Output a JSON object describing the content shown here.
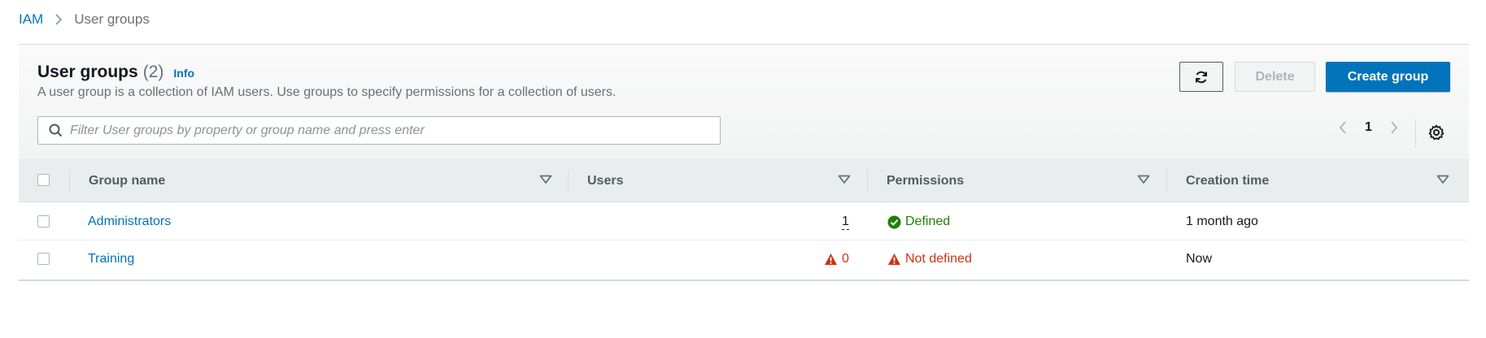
{
  "breadcrumb": {
    "root": "IAM",
    "current": "User groups"
  },
  "header": {
    "title": "User groups",
    "count": "(2)",
    "info": "Info",
    "description": "A user group is a collection of IAM users. Use groups to specify permissions for a collection of users."
  },
  "actions": {
    "refresh_icon": "refresh-icon",
    "delete_label": "Delete",
    "create_label": "Create group"
  },
  "search": {
    "placeholder": "Filter User groups by property or group name and press enter",
    "value": ""
  },
  "pagination": {
    "current_page": "1"
  },
  "table": {
    "columns": [
      "Group name",
      "Users",
      "Permissions",
      "Creation time"
    ],
    "rows": [
      {
        "name": "Administrators",
        "users": "1",
        "users_warning": false,
        "permissions": "Defined",
        "permissions_status": "ok",
        "created": "1 month ago"
      },
      {
        "name": "Training",
        "users": "0",
        "users_warning": true,
        "permissions": "Not defined",
        "permissions_status": "error",
        "created": "Now"
      }
    ]
  },
  "colors": {
    "link": "#0073bb",
    "success": "#1d8102",
    "error": "#d13212",
    "primary_button": "#0073bb"
  }
}
